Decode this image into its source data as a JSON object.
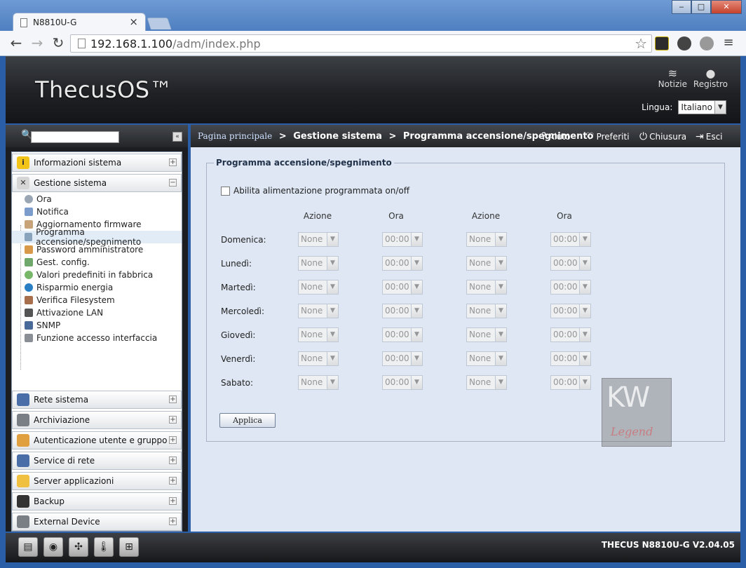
{
  "browser": {
    "tab_title": "N8810U-G",
    "tab_close": "×",
    "url_host": "192.168.1.100",
    "url_path": "/adm/index.php",
    "win_min": "‒",
    "win_max": "□",
    "win_close": "✕"
  },
  "header": {
    "brand": "ThecusOS™",
    "notizie": "Notizie",
    "registro": "Registro",
    "lingua_label": "Lingua:",
    "lingua_value": "Italiano"
  },
  "sidebar": {
    "search_placeholder": "",
    "categories": [
      {
        "label": "Informazioni sistema",
        "toggle": "+"
      },
      {
        "label": "Gestione sistema",
        "toggle": "−"
      },
      {
        "label": "Rete sistema",
        "toggle": "+"
      },
      {
        "label": "Archiviazione",
        "toggle": "+"
      },
      {
        "label": "Autenticazione utente e gruppo",
        "toggle": "+"
      },
      {
        "label": "Service di rete",
        "toggle": "+"
      },
      {
        "label": "Server applicazioni",
        "toggle": "+"
      },
      {
        "label": "Backup",
        "toggle": "+"
      },
      {
        "label": "External Device",
        "toggle": "+"
      }
    ],
    "subitems": [
      {
        "label": "Ora"
      },
      {
        "label": "Notifica"
      },
      {
        "label": "Aggiornamento firmware"
      },
      {
        "label": "Programma accensione/spegnimento"
      },
      {
        "label": "Password amministratore"
      },
      {
        "label": "Gest. config."
      },
      {
        "label": "Valori predefiniti in fabbrica"
      },
      {
        "label": "Risparmio energia"
      },
      {
        "label": "Verifica Filesystem"
      },
      {
        "label": "Attivazione LAN"
      },
      {
        "label": "SNMP"
      },
      {
        "label": "Funzione accesso interfaccia"
      }
    ]
  },
  "breadcrumb": {
    "home": "Pagina principale",
    "sep": ">",
    "level1": "Gestione sistema",
    "level2": "Programma accensione/spegnimento"
  },
  "tools": {
    "aiuto": "Aiuto",
    "preferiti": "Preferiti",
    "chiusura": "Chiusura",
    "esci": "Esci"
  },
  "form": {
    "legend": "Programma accensione/spegnimento",
    "enable_label": "Abilita alimentazione programmata on/off",
    "col_azione": "Azione",
    "col_ora": "Ora",
    "action_default": "None",
    "time_default": "00:00",
    "days": [
      {
        "label": "Domenica:"
      },
      {
        "label": "Lunedì:"
      },
      {
        "label": "Martedì:"
      },
      {
        "label": "Mercoledì:"
      },
      {
        "label": "Giovedì:"
      },
      {
        "label": "Venerdì:"
      },
      {
        "label": "Sabato:"
      }
    ],
    "apply_label": "Applica"
  },
  "watermark": {
    "mark": "KW",
    "word": "Legend"
  },
  "footer": {
    "version": "THECUS N8810U-G V2.04.05"
  },
  "colors": {
    "header_dark": "#1f2125",
    "main_bg": "#dee7f3",
    "breadcrumb_link": "#cfe0ff"
  }
}
